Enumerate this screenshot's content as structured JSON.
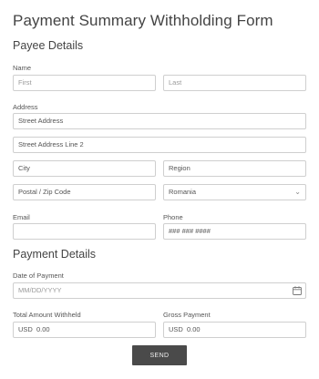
{
  "form": {
    "title": "Payment Summary Withholding Form",
    "payee_section": "Payee Details",
    "payment_section": "Payment Details",
    "send_label": "SEND"
  },
  "name": {
    "label": "Name",
    "first_placeholder": "First",
    "last_placeholder": "Last"
  },
  "address": {
    "label": "Address",
    "street_placeholder": "Street Address",
    "street2_placeholder": "Street Address Line 2",
    "city_placeholder": "City",
    "region_placeholder": "Region",
    "postal_placeholder": "Postal / Zip Code",
    "country_value": "Romania"
  },
  "contact": {
    "email_label": "Email",
    "phone_label": "Phone",
    "phone_placeholder": "### ### ####"
  },
  "payment": {
    "date_label": "Date of Payment",
    "date_placeholder": "MM/DD/YYYY",
    "total_label": "Total Amount Withheld",
    "total_value": "USD  0.00",
    "gross_label": "Gross Payment",
    "gross_value": "USD  0.00"
  },
  "icons": {
    "dropdown": "chevron-down-icon",
    "calendar": "calendar-icon"
  }
}
